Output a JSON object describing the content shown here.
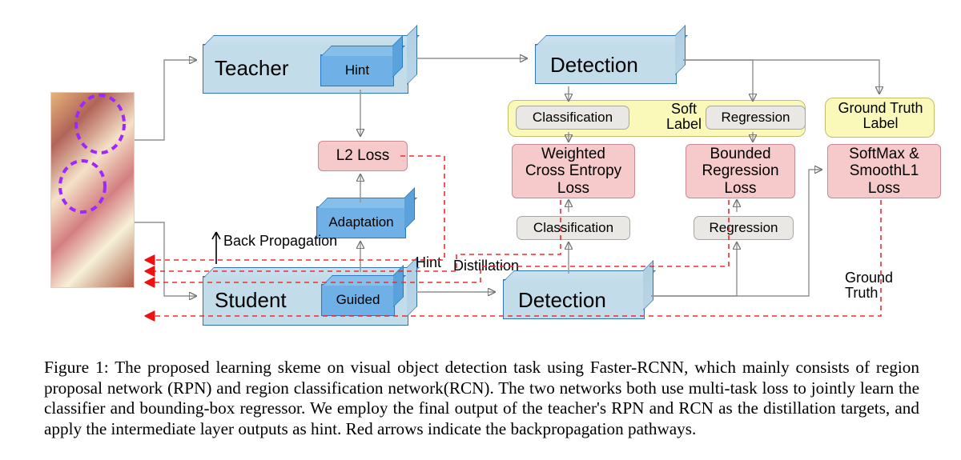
{
  "diagram": {
    "image_annotations_note": "dashed-ellipses-on-faces",
    "teacher": {
      "label": "Teacher",
      "hint_label": "Hint"
    },
    "student": {
      "label": "Student",
      "guided_label": "Guided"
    },
    "adaptation": {
      "label": "Adaptation"
    },
    "detection_top": {
      "label": "Detection"
    },
    "detection_bottom": {
      "label": "Detection"
    },
    "l2loss": {
      "label": "L2 Loss"
    },
    "softlabel_box": {
      "label": "Soft\nLabel",
      "classification": "Classification",
      "regression": "Regression"
    },
    "wce": {
      "label": "Weighted\nCross Entropy\nLoss"
    },
    "brl": {
      "label": "Bounded\nRegression\nLoss"
    },
    "cls_bottom": {
      "label": "Classification"
    },
    "reg_bottom": {
      "label": "Regression"
    },
    "gt_box": {
      "label": "Ground Truth\nLabel"
    },
    "gt_loss": {
      "label": "SoftMax &\nSmoothL1\nLoss"
    },
    "annot": {
      "backprop": "Back Propagation",
      "hint": "Hint",
      "distillation": "Distillation",
      "ground_truth": "Ground\nTruth"
    }
  },
  "caption": {
    "figno": "Figure 1:",
    "body": " The proposed learning skeme on visual object detection task using Faster-RCNN, which mainly consists of region proposal network (RPN) and region classification network(RCN). The two networks both use multi-task loss to jointly learn the classifier and bounding-box regressor. We employ the final output of the teacher's RPN and RCN as the distillation targets, and apply the intermediate layer outputs as hint. Red arrows indicate the backpropagation pathways."
  },
  "watermark": ""
}
